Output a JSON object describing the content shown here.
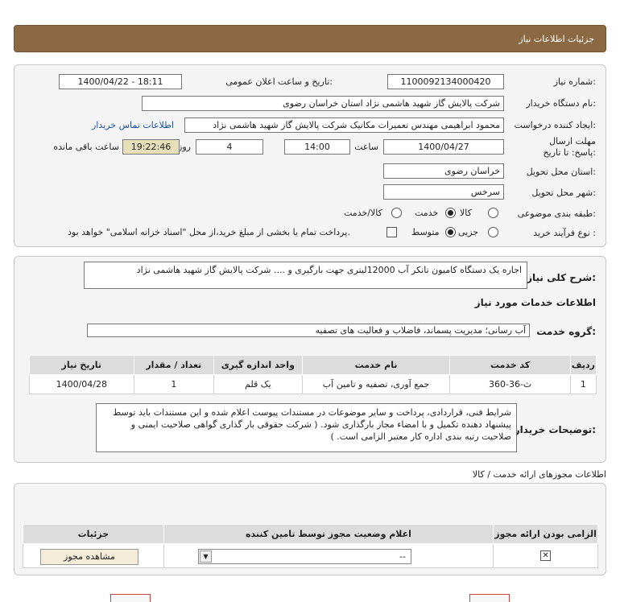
{
  "header": {
    "title": "جزئیات اطلاعات نیاز"
  },
  "form": {
    "need_number": {
      "label": "شماره نیاز:",
      "value": "1100092134000420"
    },
    "announce": {
      "label": "تاریخ و ساعت اعلان عمومی:",
      "value": "1400/04/22 - 18:11"
    },
    "buyer_org": {
      "label": "نام دستگاه خریدار:",
      "value": "شرکت پالایش گاز شهید هاشمی نژاد   استان خراسان رضوی"
    },
    "requester": {
      "label": "ایجاد کننده درخواست:",
      "value": "محمود ابراهیمی مهندس تعمیرات مکانیک شرکت پالایش گاز شهید هاشمی نژاد",
      "contact_link": "اطلاعات تماس خریدار"
    },
    "deadline": {
      "label": "مهلت ارسال پاسخ: تا تاریخ:",
      "date": "1400/04/27",
      "time_label": "ساعت",
      "time": "14:00",
      "days": "4",
      "days_label": "روز و",
      "remaining": "19:22:46",
      "remaining_label": "ساعت باقی مانده"
    },
    "delivery_province": {
      "label": "استان محل تحویل:",
      "value": "خراسان رضوی"
    },
    "delivery_city": {
      "label": "شهر محل تحویل:",
      "value": "سرخس"
    },
    "category": {
      "label": "طبقه بندی موضوعی:",
      "options": [
        "کالا",
        "خدمت",
        "کالا/خدمت"
      ],
      "selected": "خدمت"
    },
    "purchase_type": {
      "label": "نوع فرآیند خرید :",
      "options": [
        "جزیی",
        "متوسط"
      ],
      "selected": "متوسط",
      "payment_note": "پرداخت تمام یا بخشی از مبلغ خرید،از محل \"اسناد خزانه اسلامی\" خواهد بود."
    }
  },
  "summary": {
    "label": "شرح کلی نیاز:",
    "value": "اجاره یک دستگاه کامیون تانکر آب 12000لیتری جهت بارگیری و .... شرکت پالایش گاز شهید هاشمی نژاد"
  },
  "services_title": "اطلاعات خدمات مورد نیاز",
  "service_group": {
    "label": "گروه خدمت:",
    "value": "آب رسانی؛ مدیریت پسماند، فاضلاب و فعالیت های تصفیه"
  },
  "services_table": {
    "headers": [
      "ردیف",
      "کد خدمت",
      "نام خدمت",
      "واحد اندازه گیری",
      "تعداد / مقدار",
      "تاریخ نیاز"
    ],
    "rows": [
      [
        "1",
        "ث-36-360",
        "جمع آوری، تصفیه و تامین آب",
        "یک قلم",
        "1",
        "1400/04/28"
      ]
    ]
  },
  "buyer_notes": {
    "label": "توضیحات خریدار:",
    "value": "شرایط فنی، قراردادی، پرداخت و سایر موضوعات در مستندات پیوست اعلام شده و این مستندات باید توسط پیشنهاد دهنده تکمیل و با امضاء مجاز بارگذاری شود. ( شرکت حقوقی بار گذاری گواهی صلاحیت ایمنی و صلاحیت رتبه بندی اداره کار معتبر الزامی است. )"
  },
  "permits": {
    "title": "اطلاعات مجوزهای ارائه خدمت / کالا",
    "headers": [
      "الزامی بودن ارائه مجوز",
      "اعلام وضعیت مجوز توسط تامین کننده",
      "جزئیات"
    ],
    "select_value": "--",
    "view_button": "مشاهده مجوز"
  },
  "colors": {
    "header_bg": "#8b6a43",
    "link": "#1a4fa8",
    "remaining_bg": "#e6dfb8"
  },
  "icons": {
    "checkbox_x": "✕",
    "select_arrow": "▼"
  }
}
